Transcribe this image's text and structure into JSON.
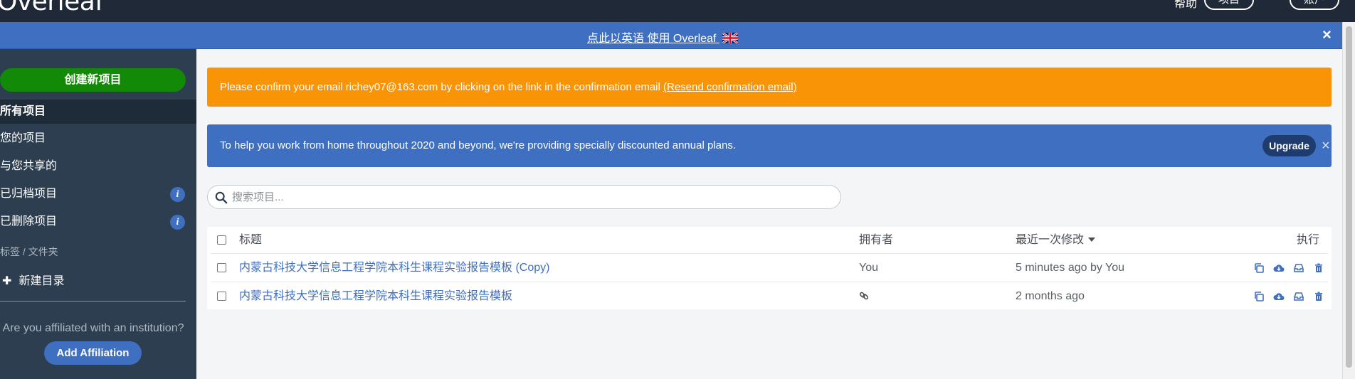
{
  "navbar": {
    "logo": "Overleaf",
    "help_label": "帮助",
    "projects_label": "项目",
    "account_label": "账户"
  },
  "lang_banner": {
    "text": "点此以英语 使用 Overleaf",
    "close": "×"
  },
  "sidebar": {
    "new_project": "创建新项目",
    "items": [
      {
        "label": "所有项目"
      },
      {
        "label": "您的项目"
      },
      {
        "label": "与您共享的"
      },
      {
        "label": "已归档项目"
      },
      {
        "label": "已删除项目"
      }
    ],
    "info_glyph": "i",
    "section_label": "标签 / 文件夹",
    "new_folder": "新建目录",
    "plus_glyph": "✚",
    "affiliation_question": "Are you affiliated with an institution?",
    "add_affiliation": "Add Affiliation"
  },
  "alerts": {
    "email_text": "Please confirm your email richey07@163.com by clicking on the link in the confirmation email ",
    "email_link": "(Resend confirmation email)",
    "promo_text": "To help you work from home throughout 2020 and beyond, we're providing specially discounted annual plans.",
    "upgrade": "Upgrade",
    "promo_close": "×"
  },
  "search": {
    "placeholder": "搜索项目..."
  },
  "table": {
    "headers": {
      "title": "标题",
      "owner": "拥有者",
      "modified": "最近一次修改",
      "actions": "执行"
    },
    "rows": [
      {
        "title": "内蒙古科技大学信息工程学院本科生课程实验报告模板 (Copy)",
        "owner": "You",
        "modified": "5 minutes ago by You"
      },
      {
        "title": "内蒙古科技大学信息工程学院本科生课程实验报告模板",
        "owner": "",
        "modified": "2 months ago"
      }
    ]
  },
  "colors": {
    "navbar": "#1f2937",
    "banner_blue": "#3f6fc1",
    "sidebar": "#2c3e50",
    "green": "#138a07",
    "orange": "#f89406"
  }
}
